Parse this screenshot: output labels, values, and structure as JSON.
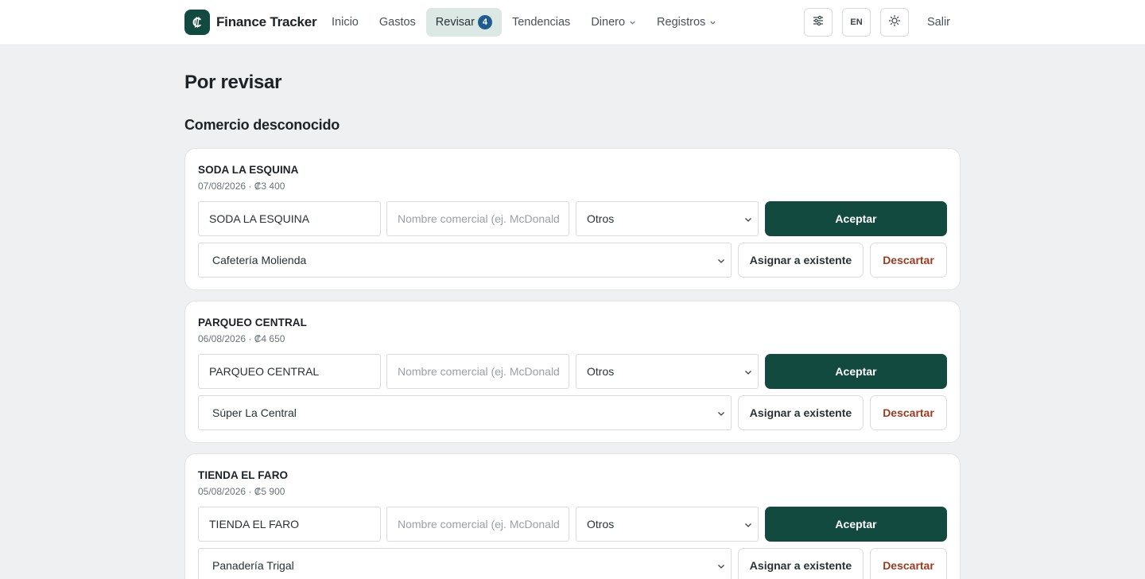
{
  "header": {
    "brand": "Finance Tracker",
    "logo_icon": "colon-currency-icon",
    "nav": [
      {
        "label": "Inicio",
        "active": false
      },
      {
        "label": "Gastos",
        "active": false
      },
      {
        "label": "Revisar",
        "active": true,
        "badge": "4"
      },
      {
        "label": "Tendencias",
        "active": false
      },
      {
        "label": "Dinero",
        "active": false,
        "dropdown": true
      },
      {
        "label": "Registros",
        "active": false,
        "dropdown": true
      }
    ],
    "settings_icon": "sliders-icon",
    "lang": "EN",
    "theme_icon": "sun-icon",
    "logout": "Salir"
  },
  "main": {
    "title": "Por revisar",
    "section_title": "Comercio desconocido",
    "accept_label": "Aceptar",
    "assign_label": "Asignar a existente",
    "discard_label": "Descartar",
    "name_placeholder": "Nombre comercial (ej. McDonald",
    "cards": [
      {
        "name": "SODA LA ESQUINA",
        "meta": "07/08/2026 · ₡3 400",
        "raw_value": "SODA LA ESQUINA",
        "category": "Otros",
        "existing": "Cafetería Molienda"
      },
      {
        "name": "PARQUEO CENTRAL",
        "meta": "06/08/2026 · ₡4 650",
        "raw_value": "PARQUEO CENTRAL",
        "category": "Otros",
        "existing": "Súper La Central"
      },
      {
        "name": "TIENDA EL FARO",
        "meta": "05/08/2026 · ₡5 900",
        "raw_value": "TIENDA EL FARO",
        "category": "Otros",
        "existing": "Panadería Trigal"
      }
    ]
  },
  "colors": {
    "primary": "#134a40",
    "badge": "#1f5d8f",
    "discard": "#9b3b22",
    "background": "#eef0f1"
  }
}
